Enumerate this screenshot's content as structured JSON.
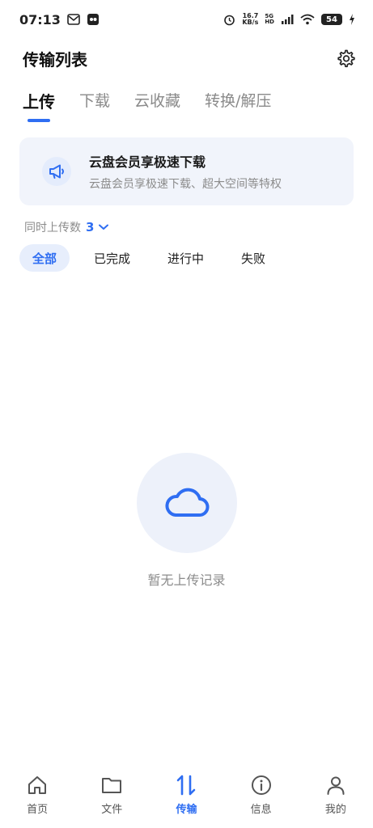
{
  "status_bar": {
    "time": "07:13",
    "speed_value": "16.7",
    "speed_unit": "KB/s",
    "net_5g": "5G",
    "net_hd": "HD",
    "battery": "54"
  },
  "header": {
    "title": "传输列表"
  },
  "tabs": [
    {
      "label": "上传",
      "active": true
    },
    {
      "label": "下载",
      "active": false
    },
    {
      "label": "云收藏",
      "active": false
    },
    {
      "label": "转换/解压",
      "active": false
    }
  ],
  "promo": {
    "title": "云盘会员享极速下载",
    "subtitle": "云盘会员享极速下载、超大空间等特权"
  },
  "concurrent": {
    "label": "同时上传数",
    "value": "3"
  },
  "filters": [
    {
      "label": "全部",
      "active": true
    },
    {
      "label": "已完成",
      "active": false
    },
    {
      "label": "进行中",
      "active": false
    },
    {
      "label": "失败",
      "active": false
    }
  ],
  "empty_state": {
    "text": "暂无上传记录"
  },
  "bottom_nav": [
    {
      "label": "首页",
      "icon": "home-icon",
      "active": false
    },
    {
      "label": "文件",
      "icon": "folder-icon",
      "active": false
    },
    {
      "label": "传输",
      "icon": "transfer-icon",
      "active": true
    },
    {
      "label": "信息",
      "icon": "info-icon",
      "active": false
    },
    {
      "label": "我的",
      "icon": "profile-icon",
      "active": false
    }
  ],
  "colors": {
    "accent": "#2f6ef2",
    "promo_bg": "#f1f4fb",
    "filter_active_bg": "#e7eefc"
  }
}
